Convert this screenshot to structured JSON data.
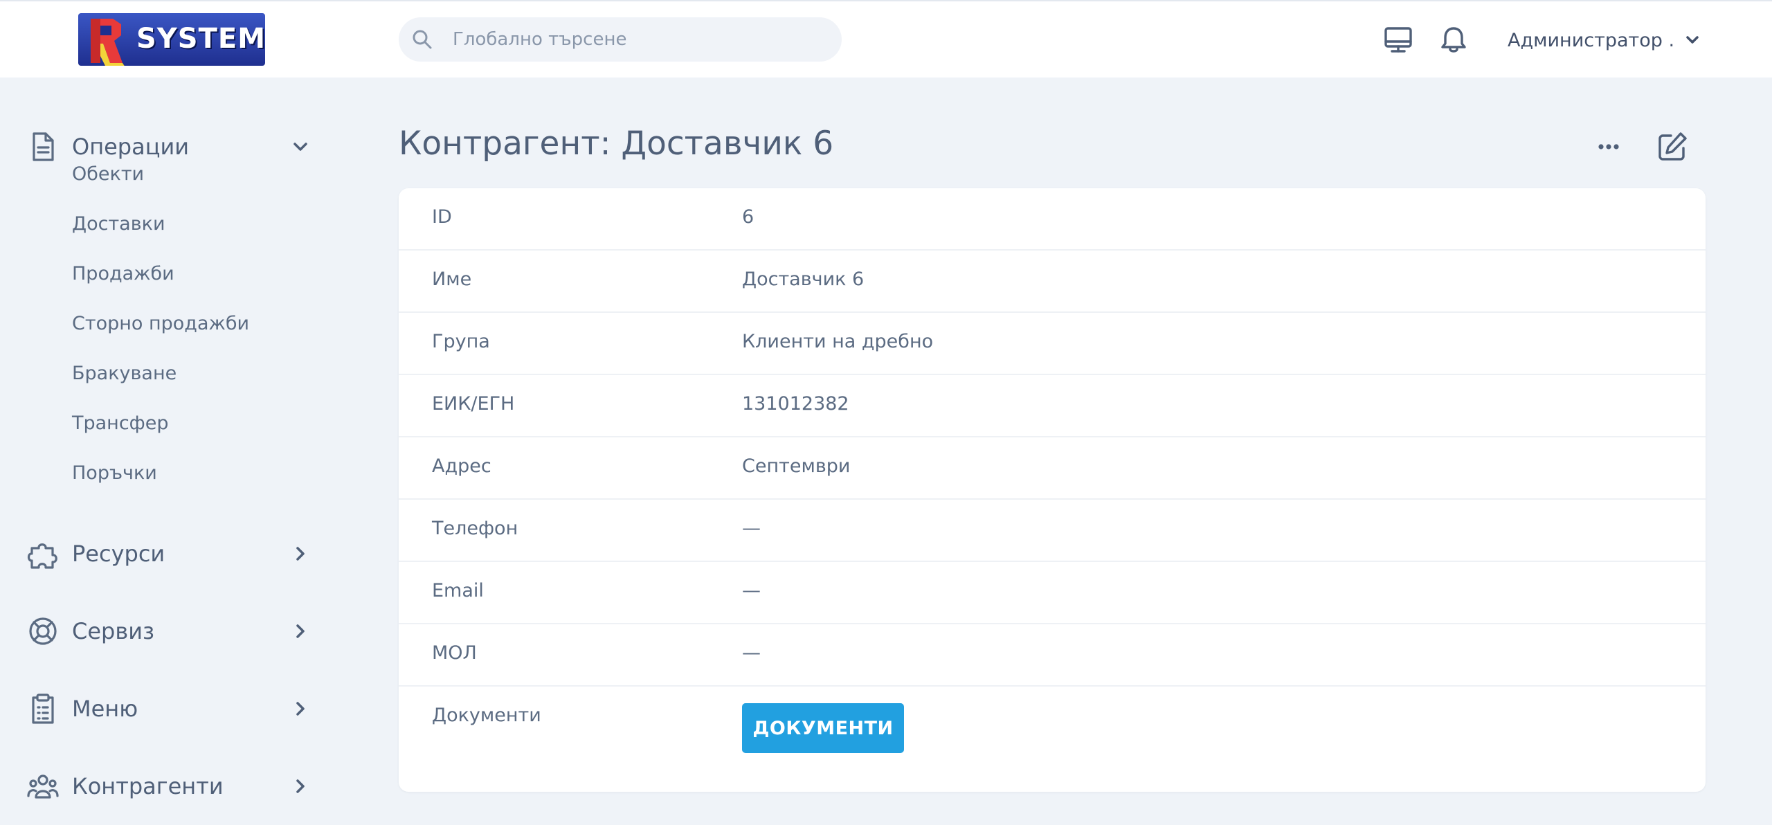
{
  "header": {
    "logo_text": "SYSTEM",
    "search_placeholder": "Глобално търсене",
    "user_name": "Администратор ."
  },
  "icons": {
    "search": "search-icon",
    "monitor": "monitor-icon",
    "bell": "bell-icon",
    "user_chevron": "chevron-down-icon",
    "more": "more-horizontal-icon",
    "edit": "edit-icon"
  },
  "sidebar": {
    "groups": [
      {
        "label": "Операции",
        "icon": "document-icon",
        "expanded": true
      },
      {
        "label": "Ресурси",
        "icon": "puzzle-icon",
        "expanded": false
      },
      {
        "label": "Сервиз",
        "icon": "lifebuoy-icon",
        "expanded": false
      },
      {
        "label": "Меню",
        "icon": "clipboard-list-icon",
        "expanded": false
      },
      {
        "label": "Контрагенти",
        "icon": "users-icon",
        "expanded": false
      }
    ],
    "operations_items": [
      {
        "label": "Обекти"
      },
      {
        "label": "Доставки"
      },
      {
        "label": "Продажби"
      },
      {
        "label": "Сторно продажби"
      },
      {
        "label": "Бракуване"
      },
      {
        "label": "Трансфер"
      },
      {
        "label": "Поръчки"
      }
    ]
  },
  "main": {
    "title": "Контрагент: Доставчик 6",
    "fields": [
      {
        "label": "ID",
        "value": "6"
      },
      {
        "label": "Име",
        "value": "Доставчик 6"
      },
      {
        "label": "Група",
        "value": "Клиенти на дребно"
      },
      {
        "label": "ЕИК/ЕГН",
        "value": "131012382"
      },
      {
        "label": "Адрес",
        "value": "Септември"
      },
      {
        "label": "Телефон",
        "value": "—"
      },
      {
        "label": "Email",
        "value": "—"
      },
      {
        "label": "МОЛ",
        "value": "—"
      },
      {
        "label": "Документи",
        "value": ""
      }
    ],
    "documents_button": "ДОКУМЕНТИ"
  },
  "colors": {
    "background": "#eff3f8",
    "accent_button": "#22a0e0",
    "text": "#5b6b82",
    "logo_blue": "#2a3fa8"
  }
}
